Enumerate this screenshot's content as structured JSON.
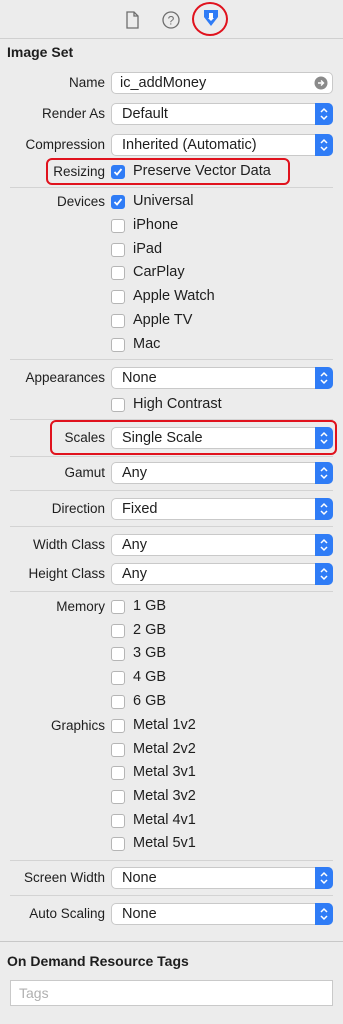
{
  "image_set": {
    "section_title": "Image Set",
    "name_label": "Name",
    "name_value": "ic_addMoney",
    "render_label": "Render As",
    "render_value": "Default",
    "compression_label": "Compression",
    "compression_value": "Inherited (Automatic)",
    "resizing_label": "Resizing",
    "resizing_option": "Preserve Vector Data",
    "devices_label": "Devices",
    "devices": [
      {
        "label": "Universal",
        "checked": true
      },
      {
        "label": "iPhone",
        "checked": false
      },
      {
        "label": "iPad",
        "checked": false
      },
      {
        "label": "CarPlay",
        "checked": false
      },
      {
        "label": "Apple Watch",
        "checked": false
      },
      {
        "label": "Apple TV",
        "checked": false
      },
      {
        "label": "Mac",
        "checked": false
      }
    ],
    "appearances_label": "Appearances",
    "appearances_value": "None",
    "high_contrast_label": "High Contrast",
    "scales_label": "Scales",
    "scales_value": "Single Scale",
    "gamut_label": "Gamut",
    "gamut_value": "Any",
    "direction_label": "Direction",
    "direction_value": "Fixed",
    "width_class_label": "Width Class",
    "width_class_value": "Any",
    "height_class_label": "Height Class",
    "height_class_value": "Any",
    "memory_label": "Memory",
    "memory": [
      "1 GB",
      "2 GB",
      "3 GB",
      "4 GB",
      "6 GB"
    ],
    "graphics_label": "Graphics",
    "graphics": [
      "Metal 1v2",
      "Metal 2v2",
      "Metal 3v1",
      "Metal 3v2",
      "Metal 4v1",
      "Metal 5v1"
    ],
    "screen_width_label": "Screen Width",
    "screen_width_value": "None",
    "auto_scaling_label": "Auto Scaling",
    "auto_scaling_value": "None"
  },
  "on_demand": {
    "section_title": "On Demand Resource Tags",
    "tags_placeholder": "Tags"
  },
  "icons": {
    "tab1": "file-icon",
    "tab2": "help-icon",
    "tab3": "attributes-inspector-icon",
    "name_go": "arrow-circle-right-icon",
    "stepper": "updown-chevron-icon",
    "checkmark": "checkmark-icon"
  },
  "colors": {
    "accent": "#2f7cf6",
    "highlight": "#e0121d"
  }
}
